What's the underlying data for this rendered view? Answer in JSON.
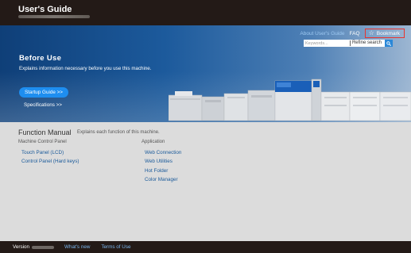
{
  "app": {
    "title": "User's Guide"
  },
  "header": {
    "about_label": "About User's Guide",
    "faq_label": "FAQ",
    "bookmark_label": "Bookmark",
    "search": {
      "placeholder": "Keywords...",
      "value": ""
    },
    "refine_label": "Refine search"
  },
  "hero": {
    "title": "Before Use",
    "description": "Explains information necessary before you use this machine.",
    "startup_label": "Startup Guide >>",
    "specifications_label": "Specifications >>"
  },
  "manual": {
    "title": "Function Manual",
    "subtitle": "Explains each function of this machine.",
    "left": {
      "heading": "Machine Control Panel",
      "items": [
        "Touch Panel (LCD)",
        "Control Panel (Hard keys)"
      ]
    },
    "right": {
      "heading": "Application",
      "items": [
        "Web Connection",
        "Web Utilities",
        "Hot Folder",
        "Color Manager"
      ]
    }
  },
  "footer": {
    "version_label": "Version",
    "whats_new": "What's new",
    "terms": "Terms of Use"
  },
  "colors": {
    "header_bg": "#231a17",
    "accent_blue": "#1e8ef0",
    "link_blue": "#1a5a9a",
    "bookmark_border": "#e8342e"
  },
  "icons": {
    "bookmark": "star-outline-icon",
    "search": "magnifier-icon"
  }
}
